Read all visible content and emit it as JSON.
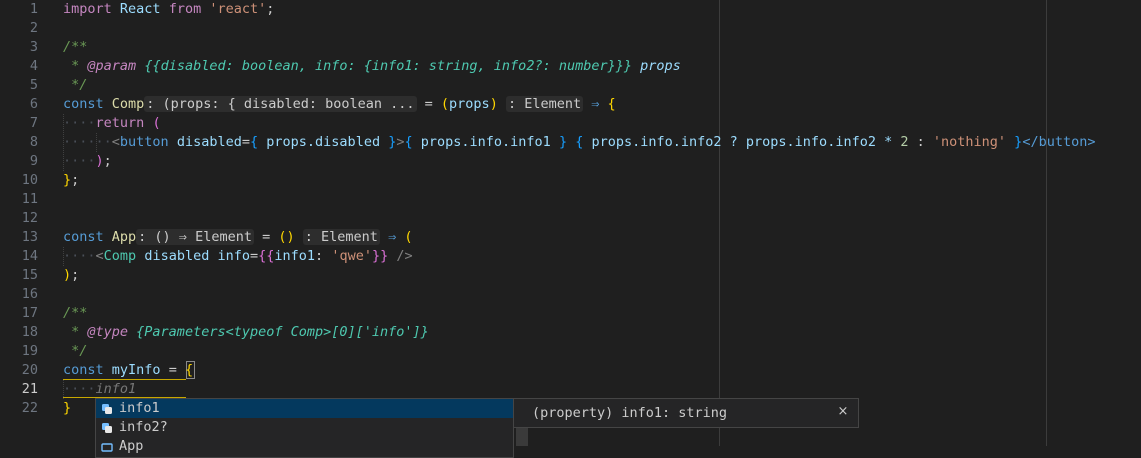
{
  "gutter": {
    "line_numbers": [
      "1",
      "2",
      "3",
      "4",
      "5",
      "6",
      "7",
      "8",
      "9",
      "10",
      "11",
      "12",
      "13",
      "14",
      "15",
      "16",
      "17",
      "18",
      "19",
      "20",
      "21",
      "22"
    ],
    "active_line": "21"
  },
  "code": {
    "l1": {
      "kw": "import",
      "name": "React",
      "from": "from",
      "mod": "'react'",
      "semi": ";"
    },
    "l3": "/**",
    "l4": {
      "star": " * ",
      "tag": "@param",
      "type": "{{disabled: boolean, info: {info1: string, info2?: number}}}",
      "name": "props"
    },
    "l5": " */",
    "l6": {
      "kw": "const",
      "name": "Comp",
      "hint": ": (props: { disabled: boolean ...",
      "eq": " = ",
      "open": "(",
      "param": "props",
      "close": ")",
      "rhint": ": Element",
      "arrow": "⇒",
      "brace": "{"
    },
    "l7": {
      "kw": "return",
      "paren": "("
    },
    "l8": {
      "lt": "<",
      "tag": "button",
      "attr": "disabled",
      "eq": "=",
      "ob1": "{",
      "expr1": " props.disabled ",
      "cb1": "}",
      "gt": ">",
      "ob2": "{",
      "expr2": " props.info.info1 ",
      "cb2": "}",
      "ob3": "{",
      "expr3a": " props.info.info2 ? props.info.info2 * ",
      "num": "2",
      "colon": " : ",
      "str": "'nothing'",
      "cb3": "}",
      "endtag": "</button>"
    },
    "l9": {
      "paren": ")",
      "semi": ";"
    },
    "l10": {
      "brace": "}",
      "semi": ";"
    },
    "l13": {
      "kw": "const",
      "name": "App",
      "hint": ": () ⇒ Element",
      "eq": " = ",
      "parens": "()",
      "rhint": ": Element",
      "arrow": "⇒",
      "paren": "("
    },
    "l14": {
      "lt": "<",
      "tag": "Comp",
      "attr1": "disabled",
      "attr2": "info",
      "eq": "=",
      "ob": "{{",
      "key": "info1",
      "colon": ": ",
      "str": "'qwe'",
      "cb": "}}",
      "end": "/>"
    },
    "l15": {
      "paren": ")",
      "semi": ";"
    },
    "l17": "/**",
    "l18": {
      "star": " * ",
      "tag": "@type",
      "type": "{Parameters<typeof Comp>[0]['info']}"
    },
    "l19": " */",
    "l20": {
      "kw": "const",
      "name": "myInfo",
      "eq": " = ",
      "brace": "{"
    },
    "l21": {
      "ghost": "info1"
    },
    "l22": "}",
    "ws2": "··",
    "ws4": "····",
    "ws6": "······"
  },
  "suggest": {
    "items": [
      {
        "label": "info1",
        "icon": "property-icon"
      },
      {
        "label": "info2?",
        "icon": "property-icon"
      },
      {
        "label": "App",
        "icon": "variable-icon"
      }
    ],
    "selected": 0
  },
  "details": {
    "text": "(property) info1: string",
    "close": "×"
  },
  "colors": {
    "background": "#1f1f1f",
    "keyword": "#569cd6",
    "bracket_gold": "#ffd700",
    "bracket_pink": "#da70d6",
    "bracket_blue": "#179fff",
    "selection": "#04395e"
  }
}
